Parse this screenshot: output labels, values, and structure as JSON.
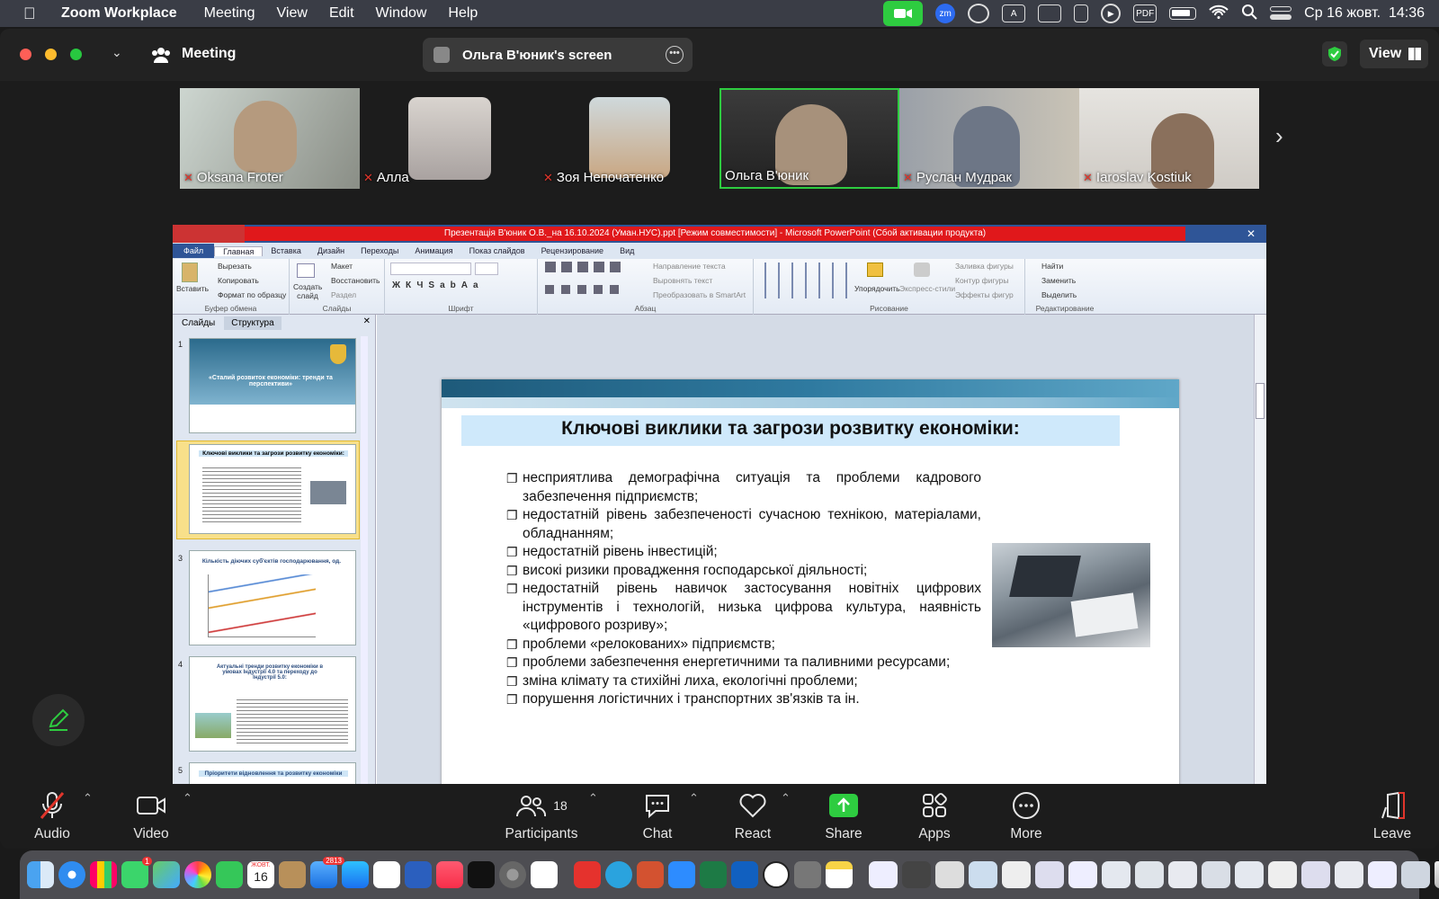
{
  "menubar": {
    "app": "Zoom Workplace",
    "items": [
      "Meeting",
      "View",
      "Edit",
      "Window",
      "Help"
    ],
    "datetime": "Ср 16 жовт.  14:36",
    "badges": {
      "zm": "zm",
      "a": "A",
      "pdf": "PDF"
    }
  },
  "window": {
    "meeting_label": "Meeting",
    "screen_label": "Ольга В'юник's screen",
    "view_label": "View"
  },
  "participants_strip": [
    {
      "name": "Oksana Froter",
      "muted": true
    },
    {
      "name": "Алла",
      "muted": true
    },
    {
      "name": "Зоя Непочатенко",
      "muted": true
    },
    {
      "name": "Ольга В'юник",
      "muted": false
    },
    {
      "name": "Руслан Мудрак",
      "muted": true
    },
    {
      "name": "Iaroslav Kostiuk",
      "muted": true
    }
  ],
  "ppt": {
    "title": "Презентація В'юник О.В._на 16.10.2024 (Уман.НУС).ppt [Режим совместимости] - Microsoft PowerPoint (Сбой активации продукта)",
    "tabs": [
      "Файл",
      "Главная",
      "Вставка",
      "Дизайн",
      "Переходы",
      "Анимация",
      "Показ слайдов",
      "Рецензирование",
      "Вид"
    ],
    "ribbon": {
      "clip": {
        "paste": "Вставить",
        "cut": "Вырезать",
        "copy": "Копировать",
        "format": "Формат по образцу",
        "label": "Буфер обмена"
      },
      "slides": {
        "create": "Создать слайд",
        "layout": "Макет",
        "reset": "Восстановить",
        "section": "Раздел",
        "label": "Слайды"
      },
      "font": {
        "label": "Шрифт"
      },
      "para": {
        "dir": "Направление текста",
        "align": "Выровнять текст",
        "convert": "Преобразовать в SmartArt",
        "label": "Абзац"
      },
      "draw": {
        "arrange": "Упорядочить",
        "styles": "Экспресс-стили",
        "fill": "Заливка фигуры",
        "outline": "Контур фигуры",
        "effects": "Эффекты фигур",
        "label": "Рисование"
      },
      "edit": {
        "find": "Найти",
        "replace": "Заменить",
        "select": "Выделить",
        "label": "Редактирование"
      }
    },
    "pane_tabs": [
      "Слайды",
      "Структура"
    ],
    "thumbs": [
      {
        "num": "1",
        "title": "«Сталий розвиток економіки: тренди та перспективи»"
      },
      {
        "num": "2",
        "title": "Ключові виклики та загрози розвитку економіки:"
      },
      {
        "num": "3",
        "title": "Кількість діючих суб'єктів господарювання, од."
      },
      {
        "num": "4",
        "title": "Актуальні тренди розвитку економіки в умовах Індустрії 4.0 та переходу до Індустрії 5.0:"
      },
      {
        "num": "5",
        "title": "Пріоритети відновлення та розвитку економіки"
      }
    ],
    "slide": {
      "title": "Ключові виклики та загрози розвитку економіки:",
      "bullets": [
        "несприятлива демографічна ситуація та проблеми кадрового забезпечення підприємств;",
        "недостатній рівень забезпеченості сучасною технікою, матеріалами, обладнанням;",
        "недостатній рівень інвестицій;",
        "високі ризики провадження господарської діяльності;",
        "недостатній рівень навичок застосування новітніх цифрових інструментів і технологій, низька цифрова культура, наявність «цифрового розриву»;",
        "проблеми «релокованих» підприємств;",
        "проблеми забезпечення енергетичними та паливними ресурсами;",
        "зміна клімату та стихійні лиха, екологічні проблеми;",
        "порушення логістичних і транспортних зв'язків та ін."
      ]
    }
  },
  "toolbar": {
    "audio": "Audio",
    "video": "Video",
    "participants": "Participants",
    "participant_count": "18",
    "chat": "Chat",
    "react": "React",
    "share": "Share",
    "apps": "Apps",
    "more": "More",
    "leave": "Leave"
  },
  "dock": {
    "calendar_month": "ЖОВТ.",
    "calendar_day": "16",
    "messages_badge": "1",
    "mail_badge": "2813"
  },
  "colors": {
    "accent_green": "#2ecc40",
    "mute_red": "#e0352b",
    "ppt_blue": "#2f5597",
    "titlebar_red": "#e0181b"
  }
}
